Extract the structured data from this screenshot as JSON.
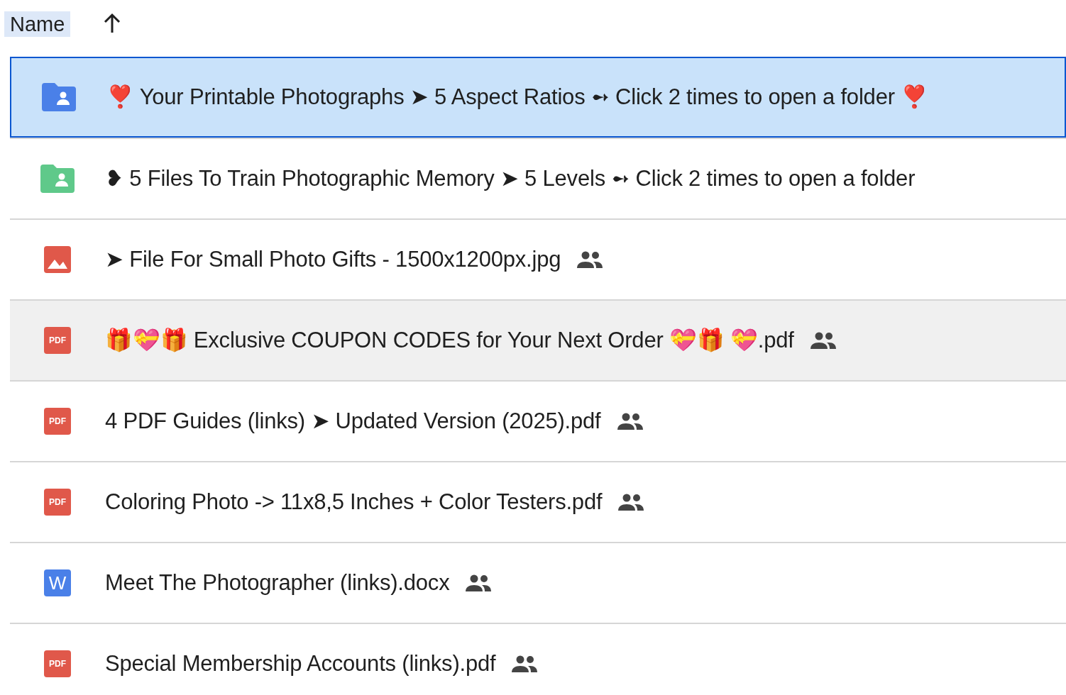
{
  "header": {
    "label": "Name",
    "selected": true
  },
  "rows": [
    {
      "kind": "folder",
      "color": "#4a80e8",
      "name": "❣️ Your Printable Photographs ➤ 5 Aspect Ratios ➻ Click 2 times to open a folder ❣️",
      "selected": true,
      "hovered": false,
      "shared": false
    },
    {
      "kind": "folder",
      "color": "#5fc98a",
      "name": "❥ 5 Files To Train Photographic Memory ➤ 5 Levels ➻ Click 2 times to open a folder",
      "selected": false,
      "hovered": false,
      "shared": false
    },
    {
      "kind": "image",
      "name": "➤ File For Small Photo Gifts - 1500x1200px.jpg",
      "selected": false,
      "hovered": false,
      "shared": true
    },
    {
      "kind": "pdf",
      "icon_text": "PDF",
      "name": "🎁💝🎁 Exclusive COUPON CODES for Your Next Order 💝🎁 💝.pdf",
      "selected": false,
      "hovered": true,
      "shared": true
    },
    {
      "kind": "pdf",
      "icon_text": "PDF",
      "name": "4 PDF Guides (links) ➤ Updated Version (2025).pdf",
      "selected": false,
      "hovered": false,
      "shared": true
    },
    {
      "kind": "pdf",
      "icon_text": "PDF",
      "name": "Coloring Photo -> 11x8,5 Inches + Color Testers.pdf",
      "selected": false,
      "hovered": false,
      "shared": true
    },
    {
      "kind": "word",
      "icon_text": "W",
      "name": "Meet The Photographer (links).docx",
      "selected": false,
      "hovered": false,
      "shared": true
    },
    {
      "kind": "pdf",
      "icon_text": "PDF",
      "name": "Special Membership Accounts (links).pdf",
      "selected": false,
      "hovered": false,
      "shared": true
    }
  ]
}
